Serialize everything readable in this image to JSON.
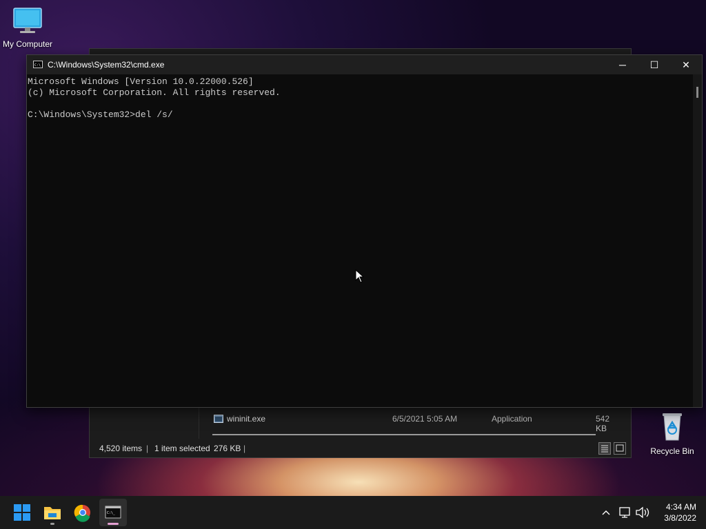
{
  "desktop": {
    "icons": [
      {
        "label": "My Computer",
        "icon": "monitor-icon"
      },
      {
        "label": "Recycle Bin",
        "icon": "recycle-bin-icon"
      }
    ]
  },
  "explorer": {
    "file": {
      "name": "wininit.exe",
      "date": "6/5/2021 5:05 AM",
      "type": "Application",
      "size": "542 KB"
    },
    "status": {
      "items": "4,520 items",
      "selected": "1 item selected",
      "selected_size": "276 KB"
    }
  },
  "cmd": {
    "title": "C:\\Windows\\System32\\cmd.exe",
    "lines": [
      "Microsoft Windows [Version 10.0.22000.526]",
      "(c) Microsoft Corporation. All rights reserved.",
      "",
      "C:\\Windows\\System32>del /s/"
    ],
    "buttons": {
      "minimize": "─",
      "maximize": "☐",
      "close": "✕"
    }
  },
  "taskbar": {
    "apps": [
      "start-icon",
      "file-explorer-icon",
      "chrome-icon",
      "terminal-icon"
    ],
    "tray": {
      "time": "4:34 AM",
      "date": "3/8/2022"
    }
  },
  "colors": {
    "accent": "#0078d4",
    "console_bg": "#0c0c0c",
    "console_text": "#cccccc"
  }
}
